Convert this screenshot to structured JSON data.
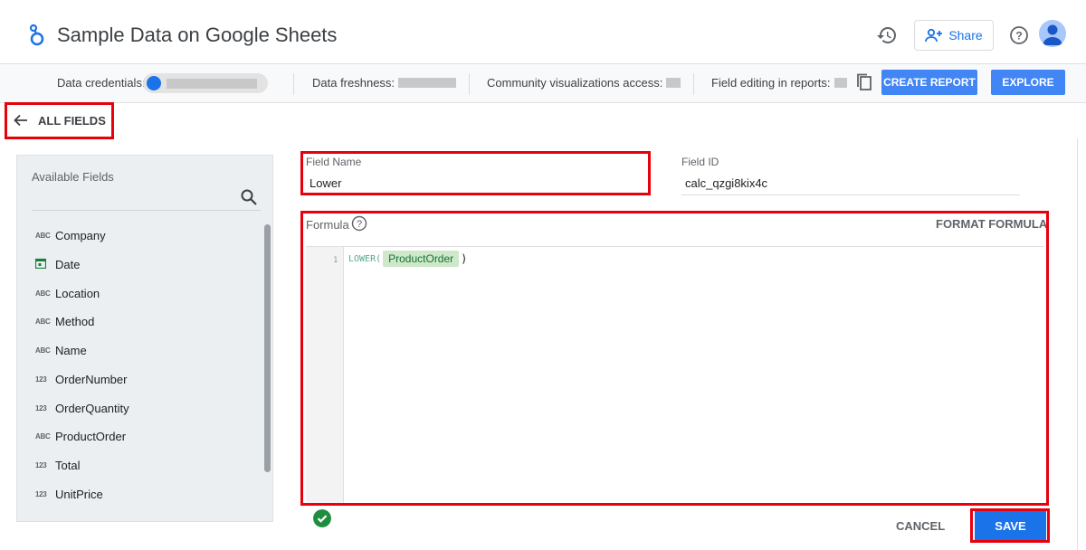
{
  "header": {
    "title": "Sample Data on Google Sheets",
    "share_label": "Share"
  },
  "toolbar": {
    "credentials_label": "Data credentials:",
    "freshness_label": "Data freshness:",
    "community_label": "Community visualizations access:",
    "field_editing_label": "Field editing in reports:",
    "create_report_label": "CREATE REPORT",
    "explore_label": "EXPLORE"
  },
  "back": {
    "label": "ALL FIELDS"
  },
  "sidebar": {
    "title": "Available Fields",
    "fields": [
      {
        "type": "ABC",
        "name": "Company"
      },
      {
        "type": "date",
        "name": "Date"
      },
      {
        "type": "ABC",
        "name": "Location"
      },
      {
        "type": "ABC",
        "name": "Method"
      },
      {
        "type": "ABC",
        "name": "Name"
      },
      {
        "type": "123",
        "name": "OrderNumber"
      },
      {
        "type": "123",
        "name": "OrderQuantity"
      },
      {
        "type": "ABC",
        "name": "ProductOrder"
      },
      {
        "type": "123",
        "name": "Total"
      },
      {
        "type": "123",
        "name": "UnitPrice"
      }
    ]
  },
  "editor": {
    "field_name_label": "Field Name",
    "field_name_value": "Lower",
    "field_id_label": "Field ID",
    "field_id_value": "calc_qzgi8kix4c",
    "formula_label": "Formula",
    "format_formula_label": "FORMAT FORMULA",
    "line_number": "1",
    "formula_fn": "LOWER(",
    "formula_arg": "ProductOrder",
    "formula_close": ")",
    "cancel_label": "CANCEL",
    "save_label": "SAVE"
  },
  "colors": {
    "accent": "#1a73e8",
    "explore_button": "#4285f4",
    "highlight": "#e8000d",
    "chip": "#cfe8c9",
    "valid": "#1e8e3e"
  },
  "icons": [
    "data-studio-logo-icon",
    "history-icon",
    "add-person-icon",
    "help-icon",
    "avatar-icon",
    "copy-icon",
    "arrow-back-icon",
    "search-icon",
    "calendar-icon",
    "help-circle-icon",
    "check-circle-icon"
  ]
}
